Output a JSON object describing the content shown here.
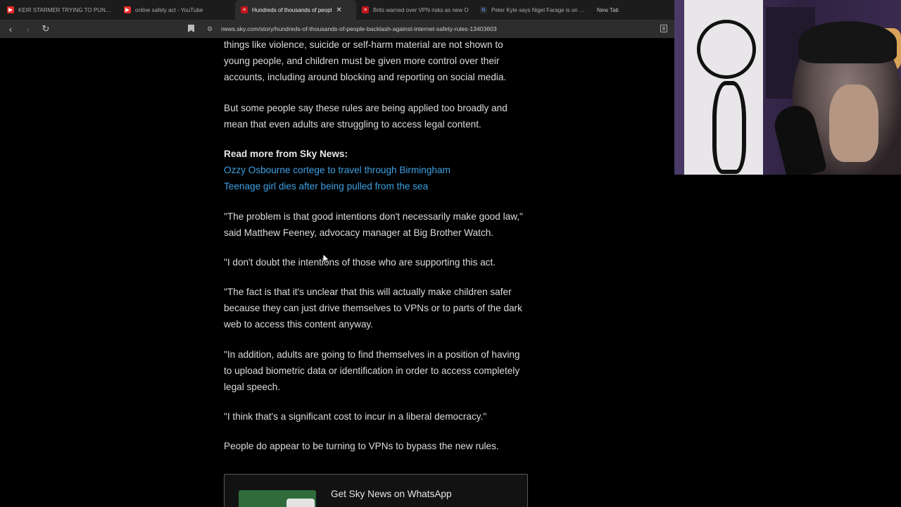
{
  "browser": {
    "tabs": [
      {
        "title": "KEIR STARMER TRYING TO PUNCH -",
        "favicon": "youtube-icon"
      },
      {
        "title": "online safety act - YouTube",
        "favicon": "youtube-icon"
      },
      {
        "title": "Hundreds of thousands of peopl",
        "favicon": "sky-news-icon",
        "active": true
      },
      {
        "title": "Brits warned over VPN risks as new O",
        "favicon": "sky-news-icon"
      },
      {
        "title": "Peter Kyle says Nigel Farage is on sid",
        "favicon": "google-icon"
      },
      {
        "title": "New Tab",
        "favicon": ""
      }
    ],
    "url": "news.sky.com/story/hundreds-of-thousands-of-people-backlash-against-internet-safety-rules-13403603"
  },
  "article": {
    "p1": "things like violence, suicide or self-harm material are not shown to young people, and children must be given more control over their accounts, including around blocking and reporting on social media.",
    "p2": "But some people say these rules are being applied too broadly and mean that even adults are struggling to access legal content.",
    "read_more_label": "Read more from Sky News:",
    "link1": "Ozzy Osbourne cortege to travel through Birmingham",
    "link2": "Teenage girl dies after being pulled from the sea",
    "p3": "\"The problem is that good intentions don't necessarily make good law,\" said Matthew Feeney, advocacy manager at Big Brother Watch.",
    "p4": "\"I don't doubt the intentions of those who are supporting this act.",
    "p5": "\"The fact is that it's unclear that this will actually make children safer because they can just drive themselves to VPNs or to parts of the dark web to access this content anyway.",
    "p6": "\"In addition, adults are going to find themselves in a position of having to upload biometric data or identification in order to access completely legal speech.",
    "p7": "\"I think that's a significant cost to incur in a liberal democracy.\"",
    "p8": "People do appear to be turning to VPNs to bypass the new rules.",
    "whatsapp_label": "Get Sky News on WhatsApp"
  },
  "colors": {
    "link": "#3ea1e3",
    "youtube": "#e52d27",
    "sky": "#c4161c"
  }
}
